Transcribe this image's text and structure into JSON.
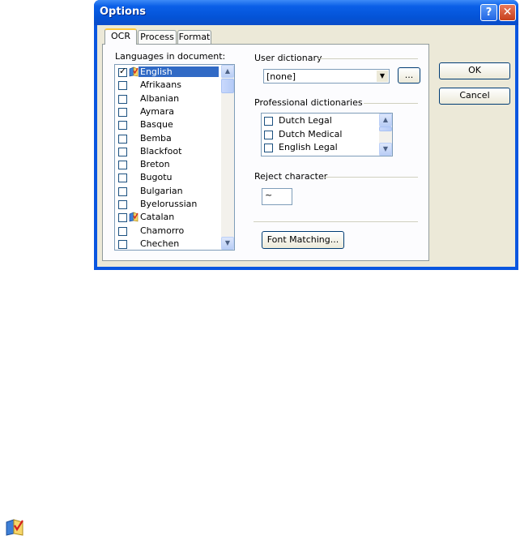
{
  "window": {
    "title": "Options",
    "help_glyph": "?",
    "close_glyph": "✕"
  },
  "tabs": [
    {
      "label": "OCR",
      "active": true
    },
    {
      "label": "Process",
      "active": false
    },
    {
      "label": "Format",
      "active": false
    }
  ],
  "languages": {
    "label": "Languages in document:",
    "items": [
      {
        "label": "English",
        "checked": true,
        "selected": true,
        "dictionary_icon": true
      },
      {
        "label": "Afrikaans",
        "checked": false
      },
      {
        "label": "Albanian",
        "checked": false
      },
      {
        "label": "Aymara",
        "checked": false
      },
      {
        "label": "Basque",
        "checked": false
      },
      {
        "label": "Bemba",
        "checked": false
      },
      {
        "label": "Blackfoot",
        "checked": false
      },
      {
        "label": "Breton",
        "checked": false
      },
      {
        "label": "Bugotu",
        "checked": false
      },
      {
        "label": "Bulgarian",
        "checked": false
      },
      {
        "label": "Byelorussian",
        "checked": false
      },
      {
        "label": "Catalan",
        "checked": false,
        "dictionary_icon": true
      },
      {
        "label": "Chamorro",
        "checked": false
      },
      {
        "label": "Chechen",
        "checked": false
      }
    ]
  },
  "user_dictionary": {
    "label": "User dictionary",
    "value": "[none]",
    "browse_label": "..."
  },
  "professional_dictionaries": {
    "label": "Professional dictionaries",
    "items": [
      {
        "label": "Dutch Legal",
        "checked": false
      },
      {
        "label": "Dutch Medical",
        "checked": false
      },
      {
        "label": "English Legal",
        "checked": false
      }
    ]
  },
  "reject_character": {
    "label": "Reject character",
    "value": "~"
  },
  "font_matching_label": "Font Matching...",
  "buttons": {
    "ok": "OK",
    "cancel": "Cancel"
  },
  "icons": {
    "dictionary": "dictionary-book-icon",
    "check": "checkmark-icon"
  },
  "colors": {
    "title_bar": "#0453d6",
    "selection": "#316ac5",
    "dialog_bg": "#ece9d8"
  }
}
